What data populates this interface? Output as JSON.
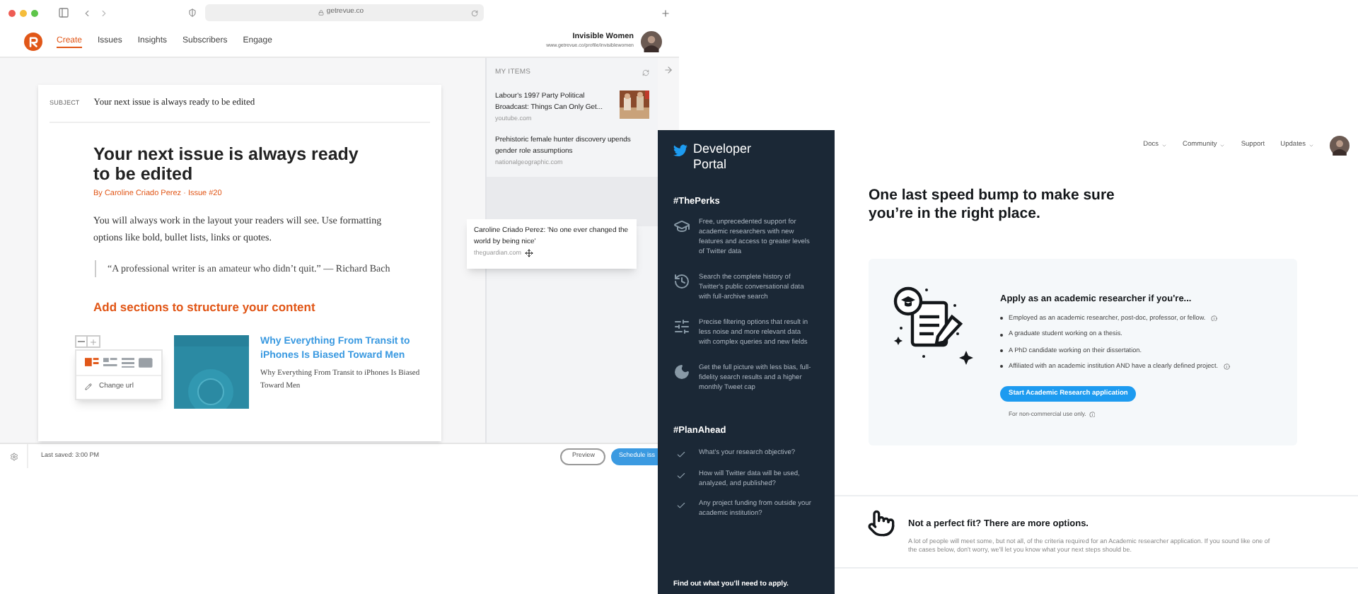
{
  "browser": {
    "url": "getrevue.co"
  },
  "revue": {
    "nav": [
      {
        "label": "Create",
        "selected": true
      },
      {
        "label": "Issues",
        "selected": false
      },
      {
        "label": "Insights",
        "selected": false
      },
      {
        "label": "Subscribers",
        "selected": false
      },
      {
        "label": "Engage",
        "selected": false
      }
    ],
    "account": {
      "name": "Invisible Women",
      "profile_url": "www.getrevue.co/profile/invisiblewomen"
    },
    "editor": {
      "subject_label": "SUBJECT",
      "subject": "Your next issue is always ready to be edited",
      "title": "Your next issue is always ready to be edited",
      "byline": "By Caroline Criado Perez · Issue #20",
      "paragraph": "You will always work in the layout your readers will see. Use formatting options like bold, bullet lists, links or quotes.",
      "quote": "“A professional writer is an amateur who didn’t quit.” — Richard Bach",
      "section_heading": "Add sections to structure your content",
      "link_item": {
        "title": "Why Everything From Transit to iPhones Is Biased Toward Men",
        "description": "Why Everything From Transit to iPhones Is Biased Toward Men"
      },
      "layout_options": [
        {
          "selected": true
        },
        {
          "selected": false
        },
        {
          "selected": false
        },
        {
          "selected": false
        }
      ],
      "item_menu": [
        "Change url"
      ]
    },
    "my_items": {
      "title": "MY ITEMS",
      "items": [
        {
          "title": "Labour's 1997 Party Political Broadcast: Things Can Only Get...",
          "source": "youtube.com",
          "thumbnail": true
        },
        {
          "title": "Prehistoric female hunter discovery upends gender role assumptions",
          "source": "nationalgeographic.com",
          "thumbnail": false
        }
      ],
      "dragged_item": {
        "title": "Caroline Criado Perez: 'No one ever changed the world by being nice'",
        "source": "theguardian.com"
      }
    },
    "footer": {
      "last_saved": "Last saved: 3:00 PM",
      "buttons": [
        {
          "label": "Preview",
          "kind": "outline"
        },
        {
          "label": "Schedule iss",
          "kind": "primary"
        }
      ]
    }
  },
  "twitter": {
    "brand": "Developer Portal",
    "sections": [
      {
        "heading": "#ThePerks",
        "items": [
          {
            "kind": "cap",
            "text": "Free, unprecedented support for academic researchers with new features and access to greater levels of Twitter data"
          },
          {
            "kind": "clock",
            "text": "Search the complete history of Twitter's public conversational data with full-archive search"
          },
          {
            "kind": "sliders",
            "text": "Precise filtering options that result in less noise and more relevant data with complex queries and new fields"
          },
          {
            "kind": "moon",
            "text": "Get the full picture with less bias, full-fidelity search results and a higher monthly Tweet cap"
          }
        ]
      },
      {
        "heading": "#PlanAhead",
        "items": [
          {
            "kind": "check",
            "text": "What's your research objective?"
          },
          {
            "kind": "check",
            "text": "How will Twitter data will be used, analyzed, and published?"
          },
          {
            "kind": "check",
            "text": "Any project funding from outside your academic institution?"
          }
        ]
      }
    ],
    "sidebar_footer": "Find out what you'll need to apply.",
    "nav": [
      {
        "label": "Docs",
        "dropdown": true
      },
      {
        "label": "Community",
        "dropdown": true
      },
      {
        "label": "Support",
        "dropdown": false
      },
      {
        "label": "Updates",
        "dropdown": true
      }
    ],
    "heading": "One last speed bump to make sure you’re in the right place.",
    "apply_card": {
      "title": "Apply as an academic researcher if you're...",
      "criteria": [
        {
          "text": "Employed as an academic researcher, post-doc, professor, or fellow.",
          "info": true
        },
        {
          "text": "A graduate student working on a thesis.",
          "info": false
        },
        {
          "text": "A PhD candidate working on their dissertation.",
          "info": false
        },
        {
          "text": "Affiliated with an academic institution AND have a clearly defined project.",
          "info": true
        }
      ],
      "button": "Start Academic Research application",
      "note": "For non-commercial use only.",
      "note_info": true
    },
    "alternatives": {
      "title": "Not a perfect fit? There are more options.",
      "text": "A lot of people will meet some, but not all, of the criteria required for an Academic researcher application. If you sound like one of the cases below, don't worry, we'll let you know what your next steps should be."
    }
  }
}
